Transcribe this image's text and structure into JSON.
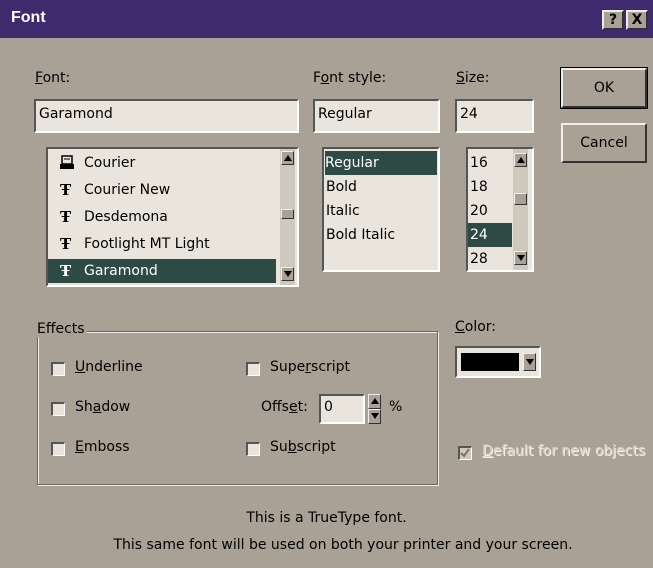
{
  "window": {
    "title": "Font",
    "help_label": "?",
    "close_label": "X"
  },
  "font": {
    "label": "Font:",
    "input_value": "Garamond",
    "items": [
      {
        "label": "Courier",
        "icon": "printer-font-icon",
        "selected": false
      },
      {
        "label": "Courier New",
        "icon": "truetype-icon",
        "selected": false
      },
      {
        "label": "Desdemona",
        "icon": "truetype-icon",
        "selected": false
      },
      {
        "label": "Footlight MT Light",
        "icon": "truetype-icon",
        "selected": false
      },
      {
        "label": "Garamond",
        "icon": "truetype-icon",
        "selected": true
      }
    ]
  },
  "font_style": {
    "label": "Font style:",
    "input_value": "Regular",
    "items": [
      "Regular",
      "Bold",
      "Italic",
      "Bold Italic"
    ],
    "selected": "Regular"
  },
  "size": {
    "label": "Size:",
    "input_value": "24",
    "items": [
      "16",
      "18",
      "20",
      "24",
      "28"
    ],
    "selected": "24"
  },
  "buttons": {
    "ok": "OK",
    "cancel": "Cancel"
  },
  "effects": {
    "title": "Effects",
    "underline": "Underline",
    "shadow": "Shadow",
    "emboss": "Emboss",
    "superscript": "Superscript",
    "offset_label": "Offset:",
    "offset_value": "0",
    "percent": "%",
    "subscript": "Subscript"
  },
  "color": {
    "label": "Color:",
    "value": "#000000"
  },
  "default_new_objects": {
    "label": "Default for new objects",
    "checked": true,
    "enabled": false
  },
  "info": {
    "line1": "This is a TrueType font.",
    "line2": "This same font will be used on both your printer and your screen."
  },
  "colors": {
    "titlebar": "#3e2a6c",
    "face": "#a9a195",
    "selection": "#2e4a45",
    "field": "#e9e4dc"
  }
}
